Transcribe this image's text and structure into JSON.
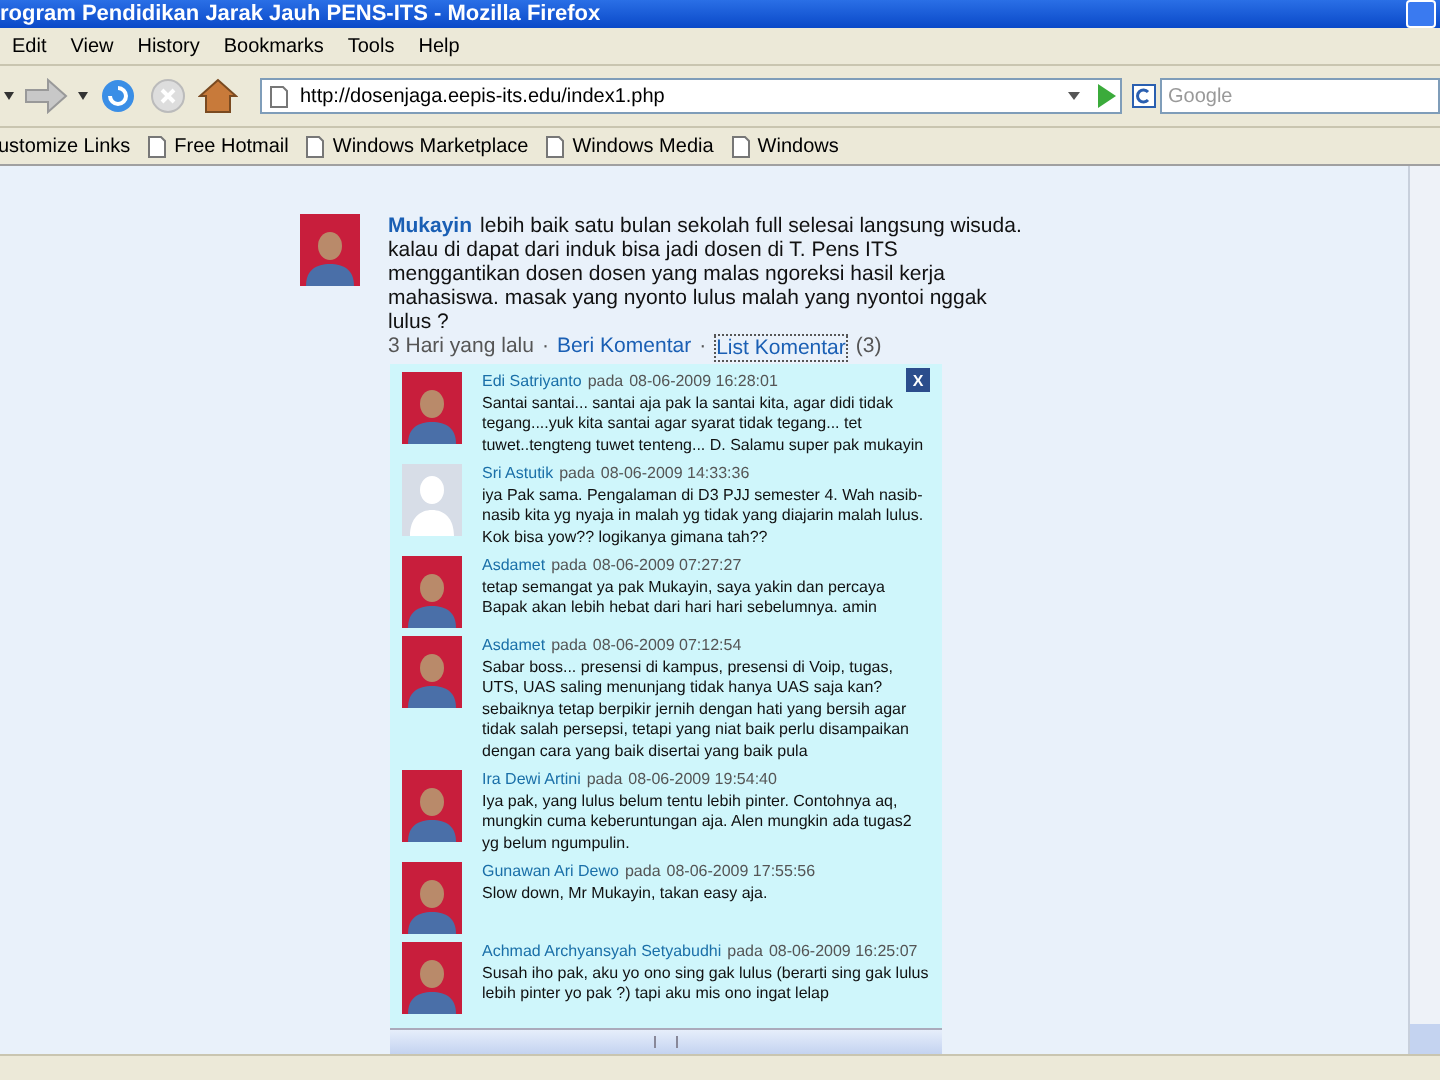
{
  "window": {
    "title": "rogram Pendidikan Jarak Jauh PENS-ITS - Mozilla Firefox"
  },
  "menu": [
    "Edit",
    "View",
    "History",
    "Bookmarks",
    "Tools",
    "Help"
  ],
  "address": {
    "value": "http://dosenjaga.eepis-its.edu/index1.php"
  },
  "search": {
    "placeholder": "Google"
  },
  "bookmarks": [
    "ustomize Links",
    "Free Hotmail",
    "Windows Marketplace",
    "Windows Media",
    "Windows"
  ],
  "post": {
    "author": "Mukayin",
    "text": "lebih baik satu bulan sekolah full selesai langsung wisuda. kalau di dapat dari induk bisa jadi dosen di T. Pens ITS menggantikan dosen dosen yang malas ngoreksi hasil kerja mahasiswa. masak yang nyonto lulus malah yang nyontoi nggak lulus ?",
    "time": "3 Hari yang lalu",
    "separator_1": "·",
    "comment_link": "Beri Komentar",
    "separator_2": "·",
    "list_link": "List Komentar",
    "count": "(3)"
  },
  "popup": {
    "close": "X",
    "comments": [
      {
        "kind": "photo",
        "name": "Edi Satriyanto",
        "on": "pada",
        "date": "08-06-2009 16:28:01",
        "text": "Santai santai... santai aja pak la santai kita, agar didi tidak tegang....yuk kita santai agar syarat tidak tegang... tet tuwet..tengteng tuwet tenteng... D. Salamu super pak mukayin"
      },
      {
        "kind": "silhouette",
        "name": "Sri Astutik",
        "on": "pada",
        "date": "08-06-2009 14:33:36",
        "text": "iya Pak sama. Pengalaman di D3 PJJ semester 4. Wah nasib-nasib kita yg nyaja in malah yg tidak yang diajarin malah lulus. Kok bisa yow?? logikanya gimana tah??"
      },
      {
        "kind": "photo",
        "name": "Asdamet",
        "on": "pada",
        "date": "08-06-2009 07:27:27",
        "text": "tetap semangat ya pak Mukayin, saya yakin dan percaya Bapak akan lebih hebat dari hari hari sebelumnya. amin"
      },
      {
        "kind": "photo",
        "name": "Asdamet",
        "on": "pada",
        "date": "08-06-2009 07:12:54",
        "text": "Sabar boss... presensi di kampus, presensi di Voip, tugas, UTS, UAS saling menunjang tidak hanya UAS saja kan? sebaiknya tetap berpikir jernih dengan hati yang bersih agar tidak salah persepsi, tetapi yang niat baik perlu disampaikan dengan cara yang baik disertai yang baik pula"
      },
      {
        "kind": "photo",
        "name": "Ira Dewi Artini",
        "on": "pada",
        "date": "08-06-2009 19:54:40",
        "text": "Iya pak, yang lulus belum tentu lebih pinter. Contohnya aq, mungkin cuma keberuntungan aja. Alen mungkin ada tugas2 yg belum ngumpulin."
      },
      {
        "kind": "photo",
        "name": "Gunawan Ari Dewo",
        "on": "pada",
        "date": "08-06-2009 17:55:56",
        "text": "Slow down, Mr Mukayin, takan easy aja."
      },
      {
        "kind": "photo",
        "name": "Achmad Archyansyah Setyabudhi",
        "on": "pada",
        "date": "08-06-2009 16:25:07",
        "text": "Susah iho pak, aku yo ono sing gak lulus (berarti sing gak lulus lebih pinter yo pak ?) tapi aku mis ono ingat lelap"
      }
    ]
  }
}
